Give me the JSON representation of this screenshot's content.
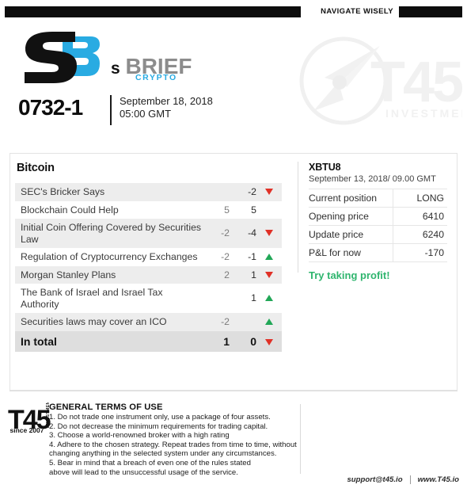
{
  "topbar": {
    "slogan": "NAVIGATE WISELY"
  },
  "masthead": {
    "logo_letter": "S",
    "logo_digit": "3",
    "brand_s": "s",
    "brand_brief": "BRIEF",
    "brand_sub": "CRYPTO",
    "issue_number": "0732-1",
    "date_line1": "September 18, 2018",
    "date_line2": "05:00 GMT",
    "watermark_text": "T45",
    "watermark_sub": "INVESTMENTS"
  },
  "news": {
    "section_title": "Bitcoin",
    "rows": [
      {
        "title": "SEC's Bricker Says",
        "v1": "",
        "v2": "-2",
        "arrow": "down"
      },
      {
        "title": "Blockchain Could Help",
        "v1": "5",
        "v2": "5",
        "arrow": "none"
      },
      {
        "title": "Initial Coin Offering Covered by Securities Law",
        "v1": "-2",
        "v2": "-4",
        "arrow": "down"
      },
      {
        "title": "Regulation of Cryptocurrency Exchanges",
        "v1": "-2",
        "v2": "-1",
        "arrow": "up"
      },
      {
        "title": "Morgan Stanley Plans",
        "v1": "2",
        "v2": "1",
        "arrow": "down"
      },
      {
        "title": "The Bank of Israel and Israel Tax Authority",
        "v1": "",
        "v2": "1",
        "arrow": "up"
      },
      {
        "title": "Securities laws may cover an ICO",
        "v1": "-2",
        "v2": "",
        "arrow": "up"
      }
    ],
    "total": {
      "title": "In total",
      "v1": "1",
      "v2": "0",
      "arrow": "down"
    }
  },
  "position": {
    "ticker": "XBTU8",
    "timestamp": "September 13, 2018/ 09.00 GMT",
    "rows": [
      {
        "label": "Current position",
        "value": "LONG",
        "style": "long"
      },
      {
        "label": "Opening price",
        "value": "6410",
        "style": "plain"
      },
      {
        "label": "Update price",
        "value": "6240",
        "style": "plain"
      },
      {
        "label": "P&L for now",
        "value": "-170",
        "style": "negative"
      }
    ],
    "advice": "Try taking profit!"
  },
  "footer": {
    "logo_text": "T45",
    "logo_vertical": "INVESTMENTS",
    "since": "since 2007",
    "terms_title": "GENERAL TERMS OF USE",
    "terms_lines": [
      "1. Do not trade one instrument only, use a package of four assets.",
      "2. Do not decrease the minimum requirements for trading capital.",
      "3. Choose a world-renowned broker with a high rating",
      "4. Adhere to the chosen strategy. Repeat trades from time to time, without",
      "changing anything in the selected system under any circumstances.",
      "5. Bear in mind that a breach of even one of the rules stated",
      "above will lead to the unsuccessful usage of the service."
    ],
    "email": "support@t45.io",
    "website": "www.T45.io"
  },
  "colors": {
    "accent_blue": "#29abe2",
    "up_green": "#21a757",
    "down_red": "#e03127",
    "long_green": "#3cba7a",
    "negative_red": "#e04a3c",
    "black": "#0d0d0d"
  }
}
